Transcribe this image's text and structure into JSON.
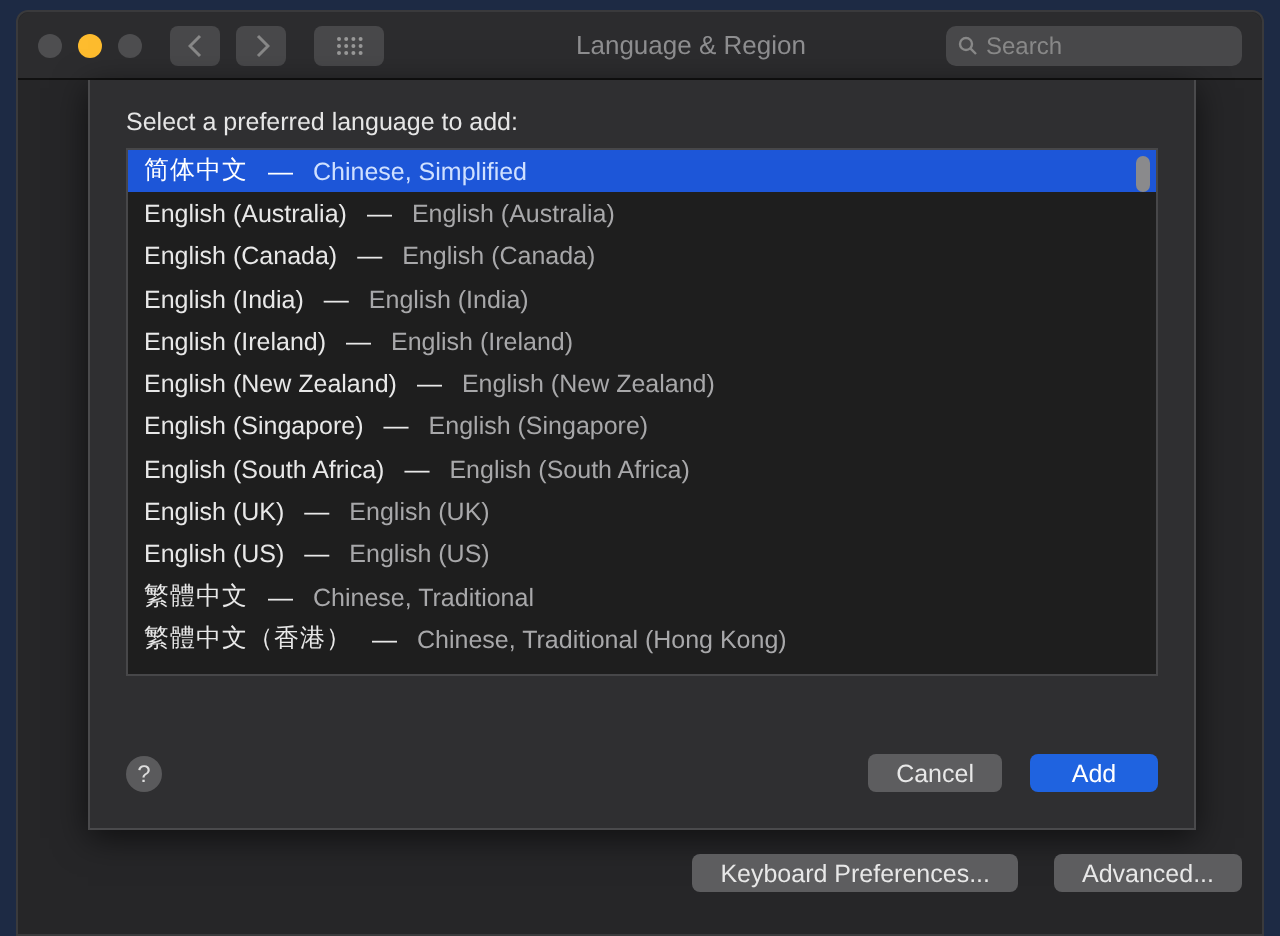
{
  "window": {
    "title": "Language & Region",
    "search": {
      "placeholder": "Search"
    }
  },
  "sheet": {
    "prompt": "Select a preferred language to add:",
    "languages": [
      {
        "name": "简体中文",
        "english": "Chinese, Simplified",
        "selected": true
      },
      {
        "name": "English (Australia)",
        "english": "English (Australia)",
        "selected": false
      },
      {
        "name": "English (Canada)",
        "english": "English (Canada)",
        "selected": false
      },
      {
        "name": "English (India)",
        "english": "English (India)",
        "selected": false
      },
      {
        "name": "English (Ireland)",
        "english": "English (Ireland)",
        "selected": false
      },
      {
        "name": "English (New Zealand)",
        "english": "English (New Zealand)",
        "selected": false
      },
      {
        "name": "English (Singapore)",
        "english": "English (Singapore)",
        "selected": false
      },
      {
        "name": "English (South Africa)",
        "english": "English (South Africa)",
        "selected": false
      },
      {
        "name": "English (UK)",
        "english": "English (UK)",
        "selected": false
      },
      {
        "name": "English (US)",
        "english": "English (US)",
        "selected": false
      },
      {
        "name": "繁體中文",
        "english": "Chinese, Traditional",
        "selected": false
      },
      {
        "name": "繁體中文（香港）",
        "english": "Chinese, Traditional (Hong Kong)",
        "selected": false
      }
    ],
    "separator": "—",
    "help": "?",
    "buttons": [
      {
        "label": "Cancel",
        "kind": "secondary"
      },
      {
        "label": "Add",
        "kind": "primary"
      }
    ]
  },
  "footer_buttons": [
    "Keyboard Preferences...",
    "Advanced..."
  ]
}
